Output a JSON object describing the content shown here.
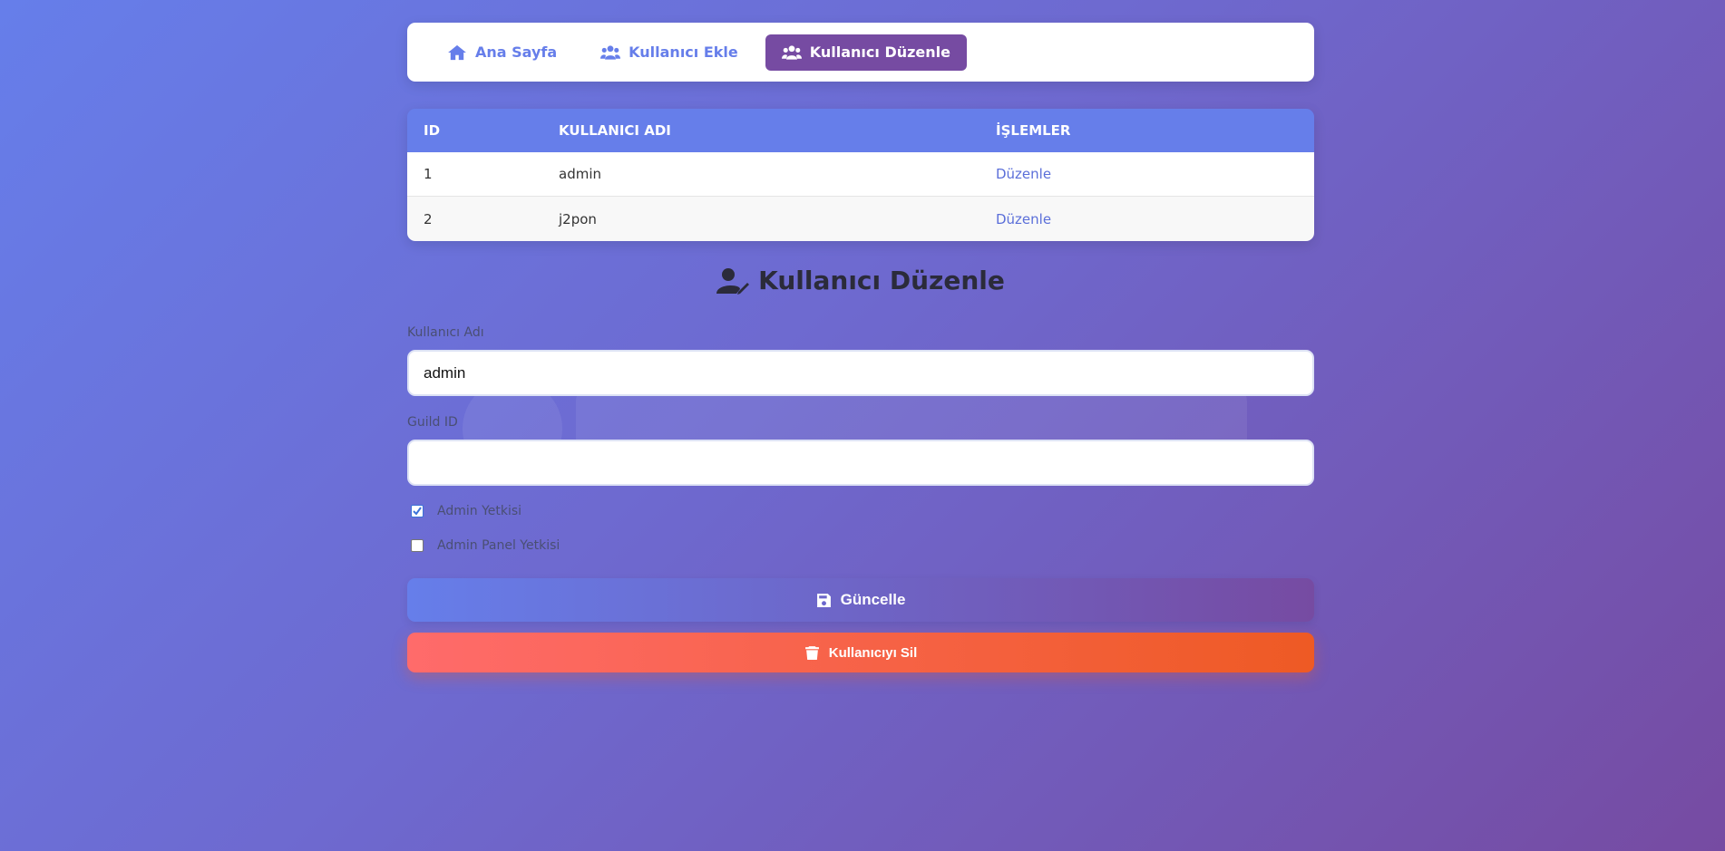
{
  "nav": {
    "items": [
      {
        "label": "Ana Sayfa",
        "icon": "home-icon",
        "active": false
      },
      {
        "label": "Kullanıcı Ekle",
        "icon": "users-icon",
        "active": false
      },
      {
        "label": "Kullanıcı Düzenle",
        "icon": "users-icon",
        "active": true
      }
    ]
  },
  "table": {
    "headers": [
      "ID",
      "KULLANICI ADI",
      "İŞLEMLER"
    ],
    "rows": [
      {
        "id": "1",
        "username": "admin",
        "action": "Düzenle"
      },
      {
        "id": "2",
        "username": "j2pon",
        "action": "Düzenle"
      }
    ]
  },
  "form": {
    "title": "Kullanıcı Düzenle",
    "title_icon": "user-edit-icon",
    "username_label": "Kullanıcı Adı",
    "username_value": "admin",
    "guild_label": "Guild ID",
    "guild_value": "",
    "admin_label": "Admin Yetkisi",
    "admin_checked": true,
    "panel_label": "Admin Panel Yetkisi",
    "panel_checked": false,
    "update_label": "Güncelle",
    "update_icon": "save-icon",
    "delete_label": "Kullanıcıyı Sil",
    "delete_icon": "trash-icon"
  },
  "colors": {
    "primary": "#667eea",
    "active_nav": "#764ba2",
    "danger_start": "#ff6b6b",
    "danger_end": "#ee5a24"
  }
}
